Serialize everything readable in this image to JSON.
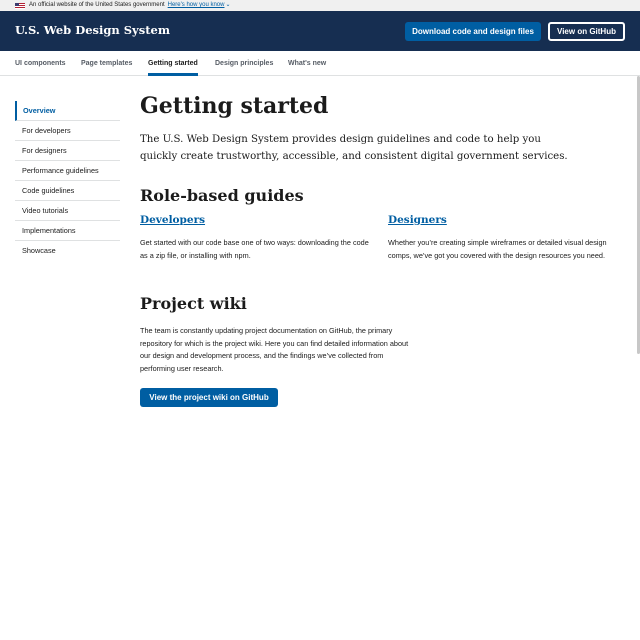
{
  "banner": {
    "text": "An official website of the United States government",
    "link": "Here's how you know",
    "icon": "chevron-down-icon"
  },
  "header": {
    "title": "U.S. Web Design System",
    "download_button": "Download code and design files",
    "github_button": "View on GitHub"
  },
  "nav": {
    "items": [
      {
        "label": "UI components"
      },
      {
        "label": "Page templates"
      },
      {
        "label": "Getting started",
        "active": true
      },
      {
        "label": "Design principles"
      },
      {
        "label": "What's new"
      }
    ]
  },
  "sidenav": {
    "items": [
      {
        "label": "Overview",
        "active": true
      },
      {
        "label": "For developers"
      },
      {
        "label": "For designers"
      },
      {
        "label": "Performance guidelines"
      },
      {
        "label": "Code guidelines"
      },
      {
        "label": "Video tutorials"
      },
      {
        "label": "Implementations"
      },
      {
        "label": "Showcase"
      }
    ]
  },
  "main": {
    "title": "Getting started",
    "lead": "The U.S. Web Design System provides design guidelines and code to help you quickly create trustworthy, accessible, and consistent digital government services.",
    "role_guides": {
      "heading": "Role-based guides",
      "developers": {
        "link": "Developers",
        "text": "Get started with our code base one of two ways: downloading the code as a zip file, or installing with npm."
      },
      "designers": {
        "link": "Designers",
        "text": "Whether you’re creating simple wireframes or detailed visual design comps, we’ve got you covered with the design resources you need."
      }
    },
    "wiki": {
      "heading": "Project wiki",
      "text": "The team is constantly updating project documentation on GitHub, the primary repository for which is the project wiki. Here you can find detailed information about our design and development process, and the findings we’ve collected from performing user research.",
      "button": "View the project wiki on GitHub"
    }
  },
  "colors": {
    "header_bg": "#162e51",
    "primary": "#005ea2",
    "banner_bg": "#f0f0f0"
  }
}
